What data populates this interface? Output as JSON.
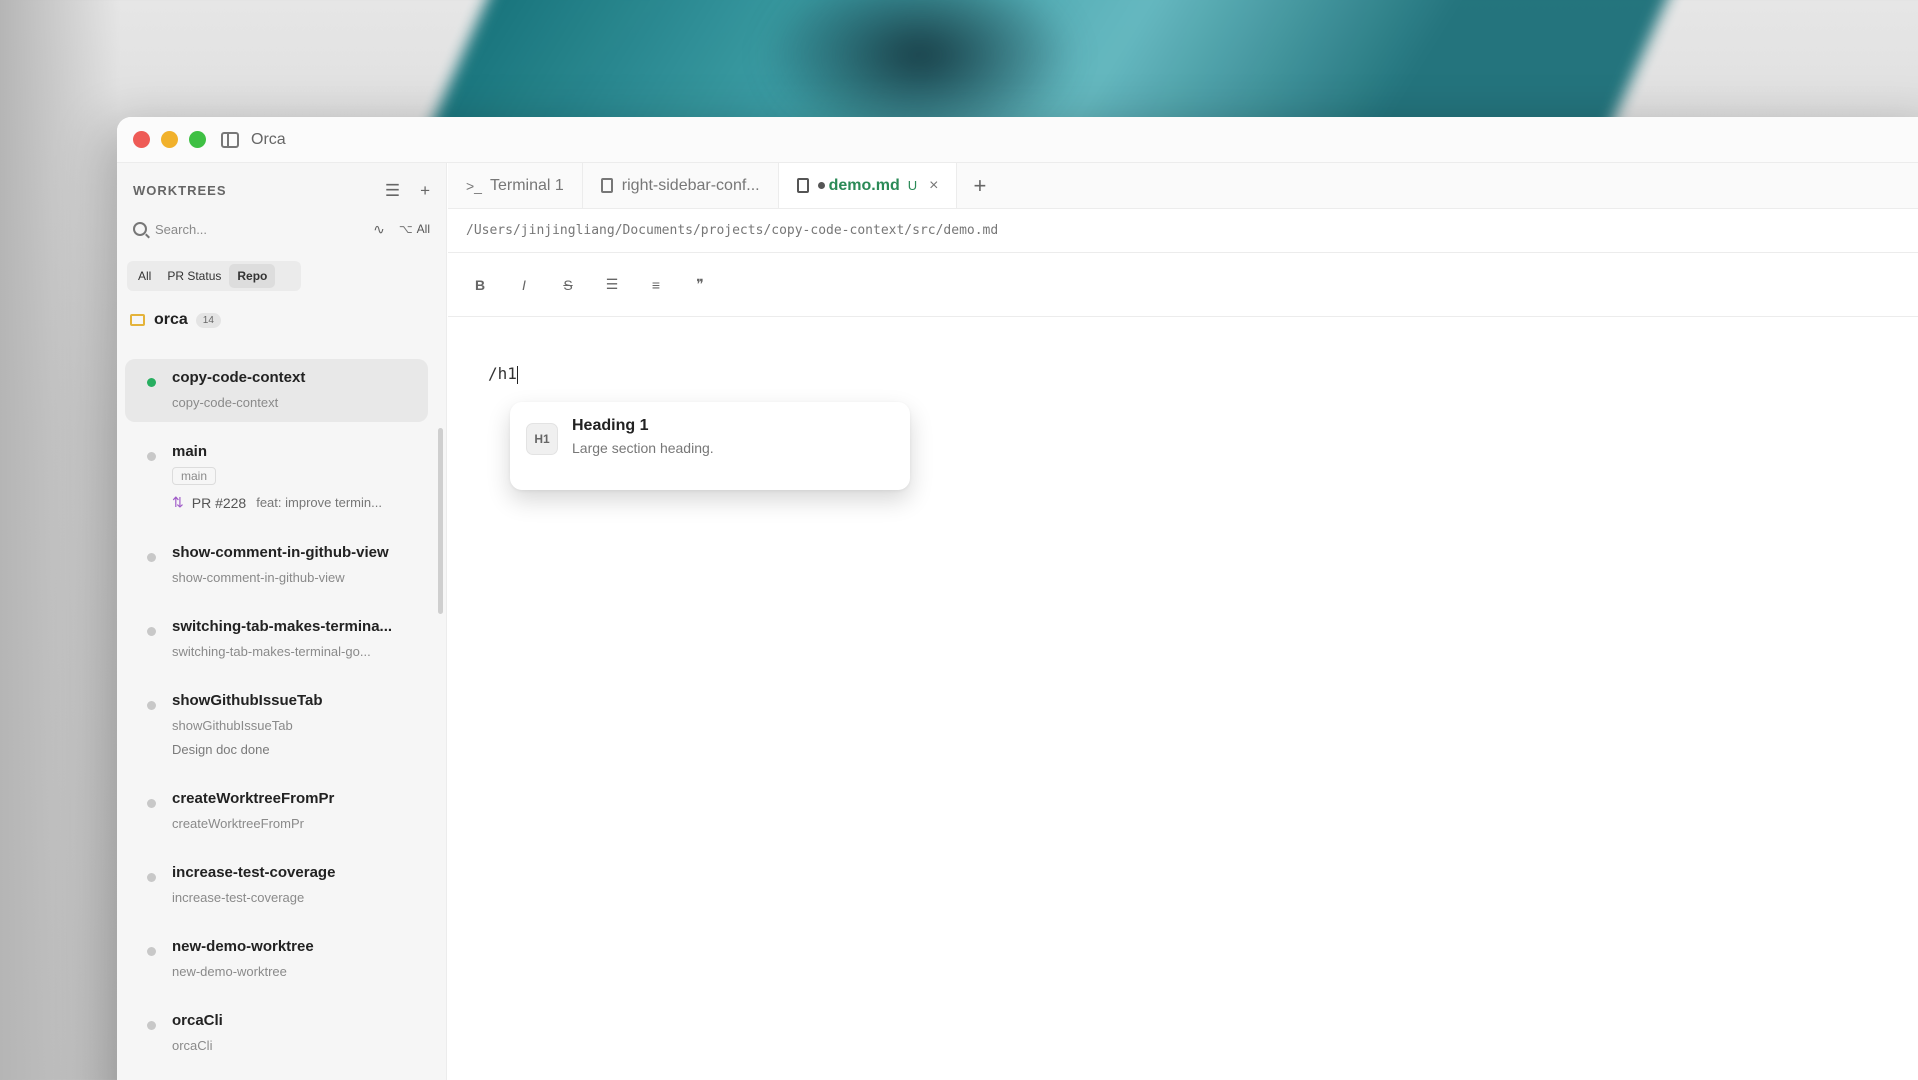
{
  "app": {
    "title": "Orca"
  },
  "sidebar": {
    "title": "WORKTREES",
    "search_placeholder": "Search...",
    "filter_label": "All",
    "segments": [
      "All",
      "PR Status",
      "Repo"
    ],
    "repo": {
      "name": "orca",
      "count": "14"
    },
    "worktrees": [
      {
        "name": "copy-code-context",
        "branch": "copy-code-context",
        "active": true
      },
      {
        "name": "main",
        "branch": "main",
        "pr_number": "PR #228",
        "pr_title": "feat: improve termin..."
      },
      {
        "name": "show-comment-in-github-view",
        "branch": "show-comment-in-github-view"
      },
      {
        "name": "switching-tab-makes-termina...",
        "branch": "switching-tab-makes-terminal-go..."
      },
      {
        "name": "showGithubIssueTab",
        "branch": "showGithubIssueTab",
        "note": "Design doc done"
      },
      {
        "name": "createWorktreeFromPr",
        "branch": "createWorktreeFromPr"
      },
      {
        "name": "increase-test-coverage",
        "branch": "increase-test-coverage"
      },
      {
        "name": "new-demo-worktree",
        "branch": "new-demo-worktree"
      },
      {
        "name": "orcaCli",
        "branch": "orcaCli"
      }
    ]
  },
  "tabs": [
    {
      "label": "Terminal 1",
      "icon": "terminal-icon"
    },
    {
      "label": "right-sidebar-conf...",
      "icon": "file-icon"
    },
    {
      "label": "demo.md",
      "icon": "file-icon",
      "badge": "U",
      "active": true
    }
  ],
  "editor": {
    "path": "/Users/jinjingliang/Documents/projects/copy-code-context/src/demo.md",
    "toolbar": [
      "B",
      "I",
      "S"
    ],
    "content": "/h1"
  },
  "slash_menu": {
    "badge": "H1",
    "title": "Heading 1",
    "description": "Large section heading."
  },
  "colors": {
    "accent_green": "#2b8a57",
    "active_dot": "#27ae60",
    "pr_icon": "#a05cc8"
  }
}
